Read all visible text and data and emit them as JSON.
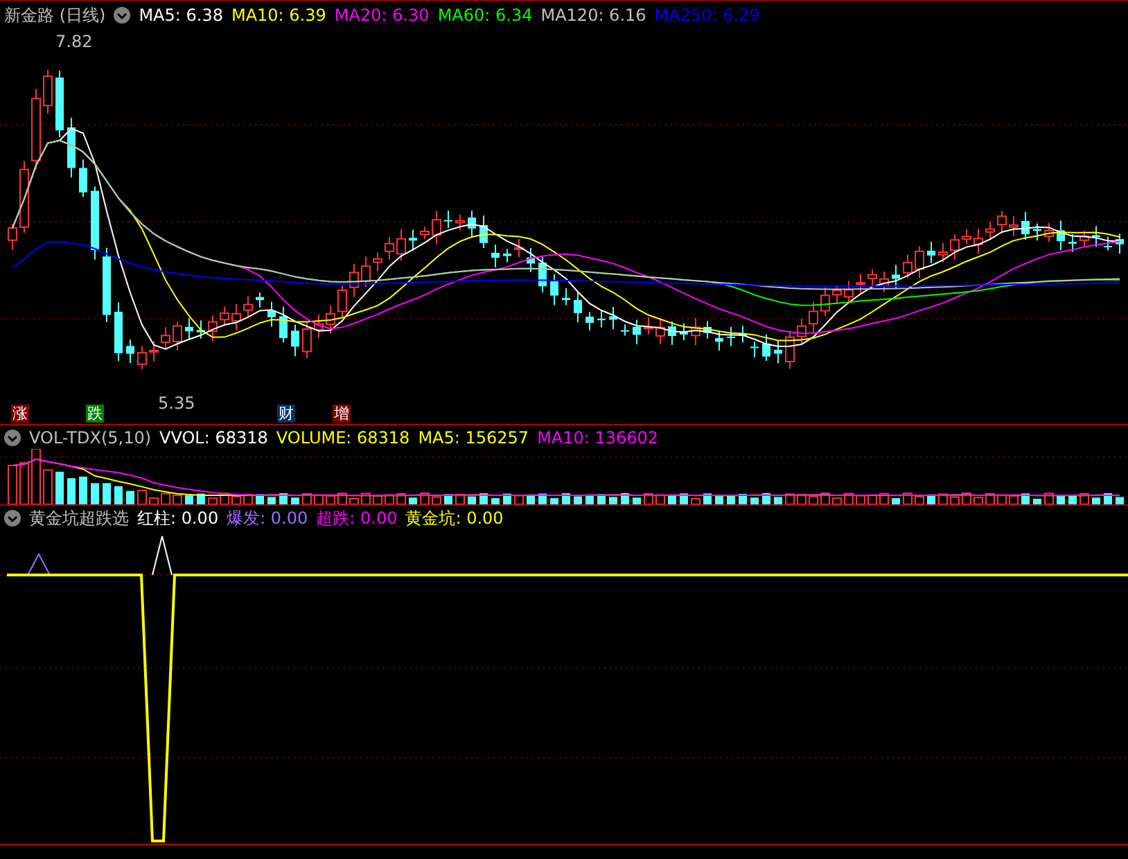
{
  "header": {
    "title": "新金路 (日线)",
    "ma": [
      {
        "text": "MA5: 6.38",
        "color": "#ffffff"
      },
      {
        "text": "MA10: 6.39",
        "color": "#ffff00"
      },
      {
        "text": "MA20: 6.30",
        "color": "#ff00ff"
      },
      {
        "text": "MA60: 6.34",
        "color": "#00ff00"
      },
      {
        "text": "MA120: 6.16",
        "color": "#c0c0c0"
      },
      {
        "text": "MA250: 6.29",
        "color": "#0000ff"
      }
    ]
  },
  "price_labels": {
    "high": "7.82",
    "low": "5.35"
  },
  "markers": [
    {
      "text": "涨",
      "color": "#800000"
    },
    {
      "text": "跌",
      "color": "#008000"
    },
    {
      "text": "财",
      "color": "#003366"
    },
    {
      "text": "增",
      "color": "#800000"
    }
  ],
  "volume": {
    "title": "VOL-TDX(5,10)",
    "items": [
      {
        "text": "VVOL: 68318",
        "color": "#ffffff"
      },
      {
        "text": "VOLUME: 68318",
        "color": "#ffff00"
      },
      {
        "text": "MA5: 156257",
        "color": "#ffff00"
      },
      {
        "text": "MA10: 136602",
        "color": "#ff00ff"
      }
    ]
  },
  "indicator": {
    "title": "黄金坑超跌选",
    "items": [
      {
        "text": "红柱: 0.00",
        "color": "#ffffff"
      },
      {
        "text": "爆发: 0.00",
        "color": "#a070ff"
      },
      {
        "text": "超跌: 0.00",
        "color": "#ff00ff"
      },
      {
        "text": "黄金坑: 0.00",
        "color": "#ffff00"
      }
    ]
  }
}
